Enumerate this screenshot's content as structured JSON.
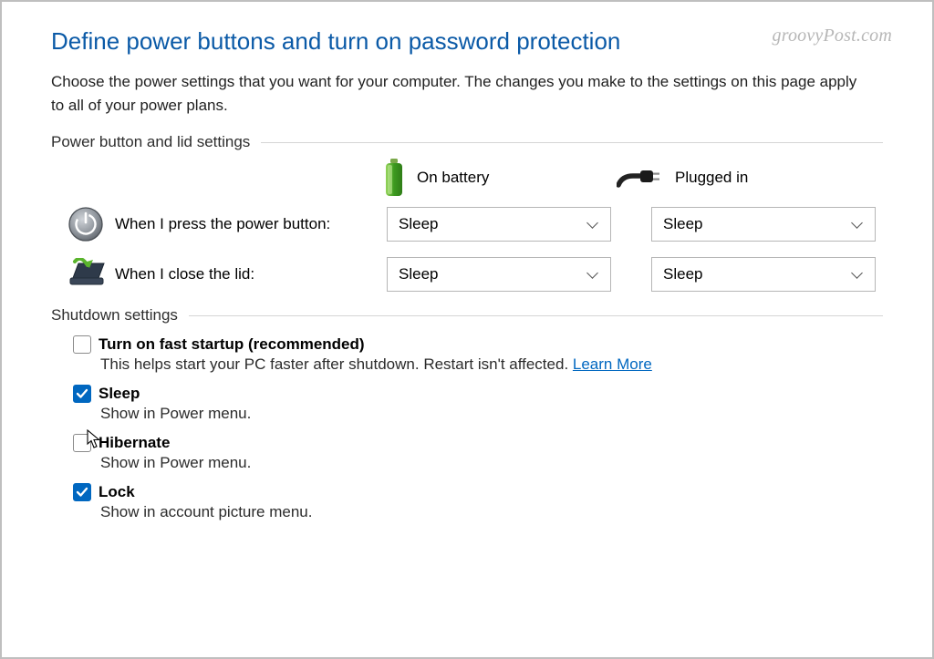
{
  "watermark": "groovyPost.com",
  "header": {
    "title": "Define power buttons and turn on password protection",
    "intro": "Choose the power settings that you want for your computer. The changes you make to the settings on this page apply to all of your power plans."
  },
  "sections": {
    "power_section_label": "Power button and lid settings",
    "shutdown_section_label": "Shutdown settings"
  },
  "columns": {
    "battery": "On battery",
    "plugged": "Plugged in"
  },
  "rows": {
    "power_button": {
      "label": "When I press the power button:",
      "battery_value": "Sleep",
      "plugged_value": "Sleep"
    },
    "close_lid": {
      "label": "When I close the lid:",
      "battery_value": "Sleep",
      "plugged_value": "Sleep"
    }
  },
  "shutdown": {
    "fast_startup": {
      "checked": false,
      "title": "Turn on fast startup (recommended)",
      "desc_pre": "This helps start your PC faster after shutdown. Restart isn't affected. ",
      "learn_more": "Learn More"
    },
    "sleep": {
      "checked": true,
      "title": "Sleep",
      "desc": "Show in Power menu."
    },
    "hibernate": {
      "checked": false,
      "title": "Hibernate",
      "desc": "Show in Power menu."
    },
    "lock": {
      "checked": true,
      "title": "Lock",
      "desc": "Show in account picture menu."
    }
  }
}
